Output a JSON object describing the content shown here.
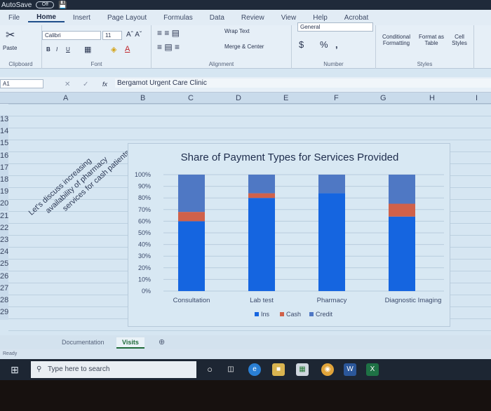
{
  "titlebar": {
    "autosave_label": "AutoSave",
    "autosave_state": "Off"
  },
  "ribbon_tabs": [
    "File",
    "Home",
    "Insert",
    "Page Layout",
    "Formulas",
    "Data",
    "Review",
    "View",
    "Help",
    "Acrobat"
  ],
  "active_tab": "Home",
  "ribbon": {
    "clipboard": {
      "label": "Clipboard",
      "paste": "Paste"
    },
    "font": {
      "label": "Font",
      "name": "Calibri",
      "size": "11",
      "bold": "B",
      "italic": "I",
      "underline": "U"
    },
    "alignment": {
      "label": "Alignment",
      "wrap_text": "Wrap Text",
      "merge_center": "Merge & Center"
    },
    "number": {
      "label": "Number",
      "format": "General",
      "currency": "$",
      "percent": "%",
      "comma": ","
    },
    "styles": {
      "label": "Styles",
      "conditional": "Conditional Formatting",
      "format_table": "Format as Table",
      "cell_styles": "Cell Styles"
    }
  },
  "formula_bar": {
    "name_box": "A1",
    "fx": "fx",
    "content": "Bergamot Urgent Care Clinic"
  },
  "columns": [
    "A",
    "B",
    "C",
    "D",
    "E",
    "F",
    "G",
    "H",
    "I"
  ],
  "rows": [
    "13",
    "14",
    "15",
    "16",
    "17",
    "18",
    "19",
    "20",
    "21",
    "22",
    "23",
    "24",
    "25",
    "26",
    "27",
    "28",
    "29"
  ],
  "note_lines": [
    "Let's discuss increasing",
    "availability of pharmacy",
    "services for cash patients"
  ],
  "sheets": [
    {
      "name": "Documentation",
      "active": false
    },
    {
      "name": "Visits",
      "active": true
    }
  ],
  "status": "Ready",
  "taskbar": {
    "search_placeholder": "Type here to search"
  },
  "chart_data": {
    "type": "bar",
    "stacked": "percent",
    "title": "Share of Payment Types for Services Provided",
    "categories": [
      "Consultation",
      "Lab test",
      "Pharmacy",
      "Diagnostic Imaging"
    ],
    "series": [
      {
        "name": "Ins",
        "color": "#1565e0",
        "values": [
          60,
          80,
          84,
          64
        ]
      },
      {
        "name": "Cash",
        "color": "#d0614a",
        "values": [
          8,
          4,
          0,
          11
        ]
      },
      {
        "name": "Credit",
        "color": "#4f78c4",
        "values": [
          32,
          16,
          16,
          25
        ]
      }
    ],
    "yticks": [
      "0%",
      "10%",
      "20%",
      "30%",
      "40%",
      "50%",
      "60%",
      "70%",
      "80%",
      "90%",
      "100%"
    ],
    "ylim": [
      0,
      100
    ],
    "xlabel": "",
    "ylabel": "",
    "grid": true,
    "legend": "bottom"
  }
}
